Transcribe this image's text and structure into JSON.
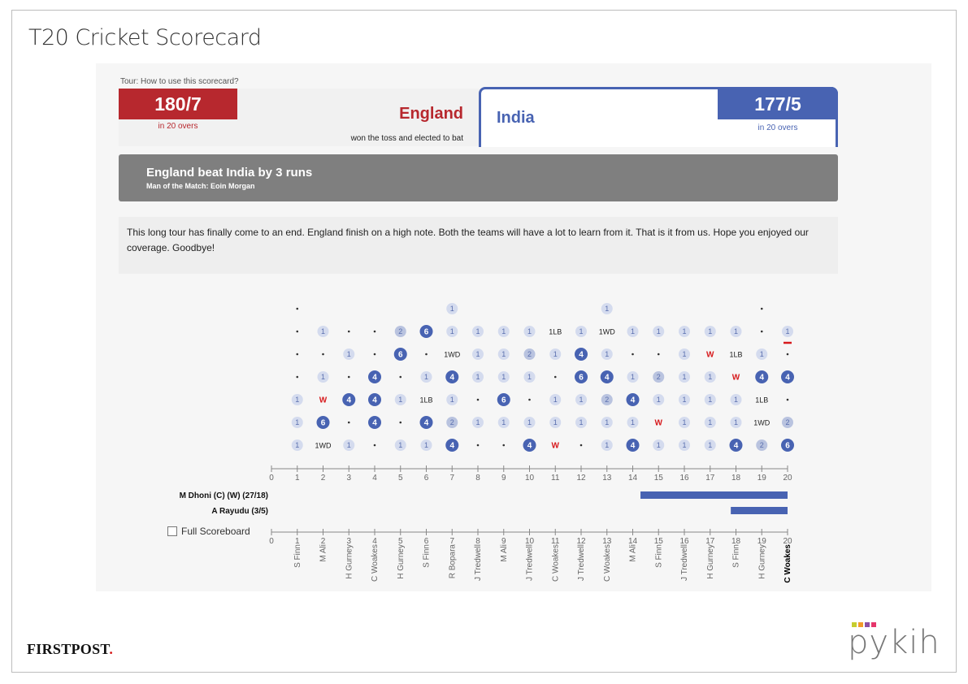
{
  "app": {
    "title": "T20 Cricket Scorecard"
  },
  "tour_link": "Tour: How to use this scorecard?",
  "england": {
    "score": "180/7",
    "overs": "in 20 overs",
    "name": "England",
    "toss": "won the toss and elected to bat",
    "color": "#b7282e"
  },
  "india": {
    "score": "177/5",
    "overs": "in 20 overs",
    "name": "India",
    "color": "#4863b2"
  },
  "result": {
    "headline": "England beat India by 3 runs",
    "motm": "Man of the Match: Eoin Morgan"
  },
  "commentary": "This long tour has finally come to an end. England finish on a high note. Both the teams will have a lot to learn from it. That is it from us. Hope you enjoyed our coverage. Goodbye!",
  "full_scoreboard_label": "Full Scoreboard",
  "footer": {
    "left_logo_text": "FIRSTPOST",
    "left_logo_dot": ".",
    "right_logo_text": "pykih"
  },
  "chart_data": {
    "type": "table",
    "title": "",
    "overs": [
      1,
      2,
      3,
      4,
      5,
      6,
      7,
      8,
      9,
      10,
      11,
      12,
      13,
      14,
      15,
      16,
      17,
      18,
      19,
      20
    ],
    "axis_ticks": [
      0,
      1,
      2,
      3,
      4,
      5,
      6,
      7,
      8,
      9,
      10,
      11,
      12,
      13,
      14,
      15,
      16,
      17,
      18,
      19,
      20
    ],
    "bowlers": [
      "S Finn",
      "M Ali",
      "H Gurney",
      "C Woakes",
      "H Gurney",
      "S Finn",
      "R Bopara",
      "J Tredwell",
      "M Ali",
      "J Tredwell",
      "C Woakes",
      "J Tredwell",
      "C Woakes",
      "M Ali",
      "S Finn",
      "J Tredwell",
      "H Gurney",
      "S Finn",
      "H Gurney",
      "C Woakes"
    ],
    "current_bowler_over": 20,
    "balls": [
      [
        "1",
        "1WD",
        "1",
        "·",
        "1",
        "1",
        "4",
        "·",
        "·",
        "4",
        "W",
        "·",
        "1",
        "4",
        "1",
        "1",
        "1",
        "4",
        "2",
        "6"
      ],
      [
        "1",
        "6",
        "·",
        "4",
        "·",
        "4",
        "2",
        "1",
        "1",
        "1",
        "1",
        "1",
        "1",
        "1",
        "W",
        "1",
        "1",
        "1",
        "1WD",
        "2"
      ],
      [
        "1",
        "W",
        "4",
        "4",
        "1",
        "1LB",
        "1",
        "·",
        "6",
        "·",
        "1",
        "1",
        "2",
        "4",
        "1",
        "1",
        "1",
        "1",
        "1LB",
        "·"
      ],
      [
        "·",
        "1",
        "·",
        "4",
        "·",
        "1",
        "4",
        "1",
        "1",
        "1",
        "·",
        "6",
        "4",
        "1",
        "2",
        "1",
        "1",
        "W",
        "4",
        "4"
      ],
      [
        "·",
        "·",
        "1",
        "·",
        "6",
        "·",
        "1WD",
        "1",
        "1",
        "2",
        "1",
        "4",
        "1",
        "·",
        "·",
        "1",
        "W",
        "1LB",
        "1",
        "·"
      ],
      [
        "·",
        "1",
        "·",
        "·",
        "2",
        "6",
        "1",
        "1",
        "1",
        "1",
        "1LB",
        "1",
        "1WD",
        "1",
        "1",
        "1",
        "1",
        "1",
        "·",
        "1"
      ],
      [
        "·",
        "",
        "",
        "",
        "",
        "",
        "1",
        "",
        "",
        "",
        "",
        "",
        "1",
        "",
        "",
        "",
        "",
        "",
        "·",
        ""
      ]
    ],
    "batsmen": [
      {
        "name": "M Dhoni (C) (W) (27/18)",
        "from_over": 14.3,
        "to_over": 20
      },
      {
        "name": "A Rayudu (3/5)",
        "from_over": 17.8,
        "to_over": 20
      }
    ],
    "colors": {
      "four": "#4863b2",
      "six": "#4863b2",
      "single": "#d4dbee",
      "two": "#b9c3df",
      "wicket": "#d7191c",
      "bar": "#4863b2",
      "current_ball_marker": "#d7191c"
    }
  }
}
